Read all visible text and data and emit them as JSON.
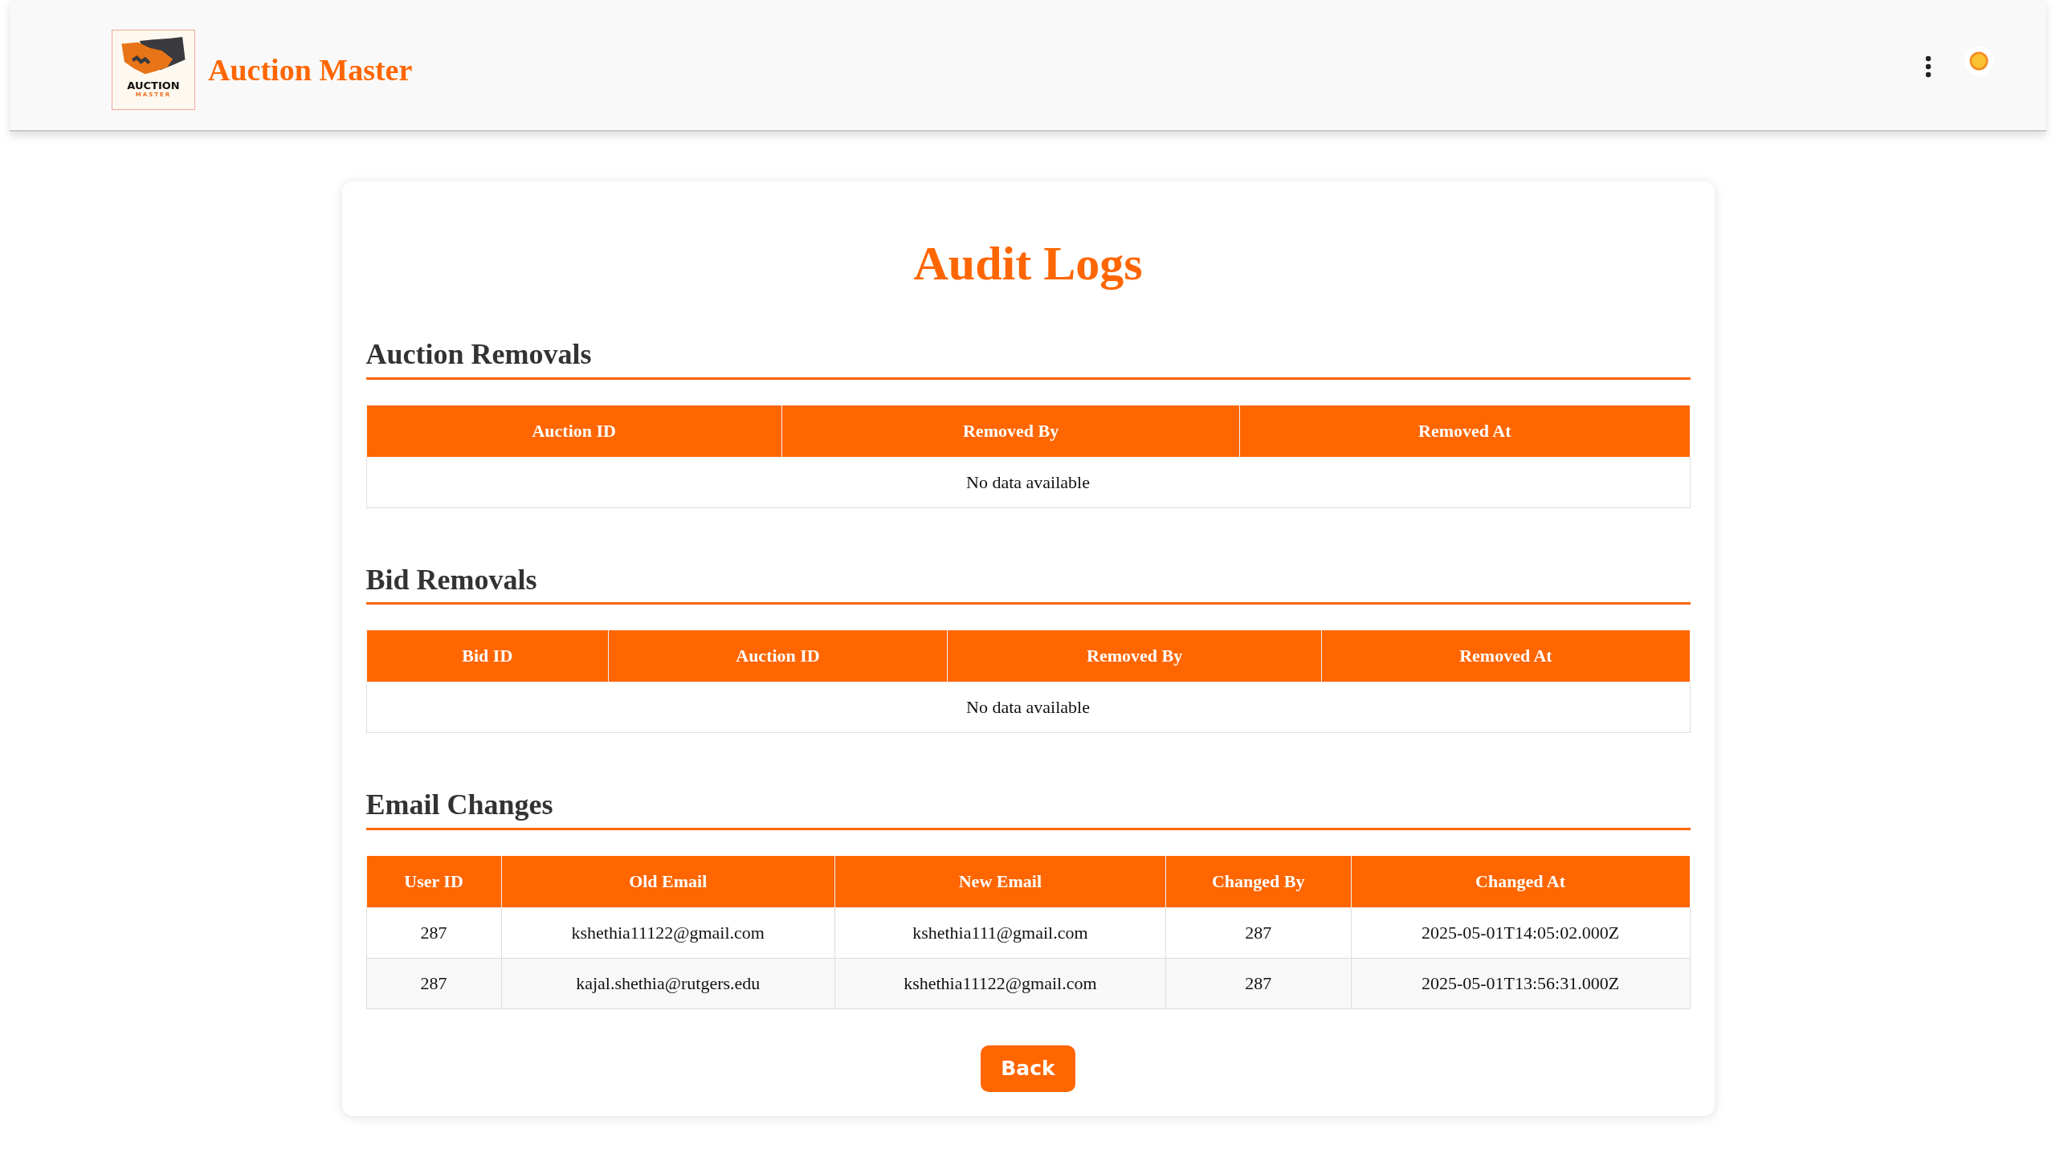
{
  "header": {
    "logo_text": "AUCTION",
    "logo_subtext": "MASTER",
    "title": "Auction Master"
  },
  "page_title": "Audit Logs",
  "sections": [
    {
      "heading": "Auction Removals",
      "columns": [
        "Auction ID",
        "Removed By",
        "Removed At"
      ],
      "empty_text": "No data available"
    },
    {
      "heading": "Bid Removals",
      "columns": [
        "Bid ID",
        "Auction ID",
        "Removed By",
        "Removed At"
      ],
      "empty_text": "No data available"
    },
    {
      "heading": "Email Changes",
      "columns": [
        "User ID",
        "Old Email",
        "New Email",
        "Changed By",
        "Changed At"
      ],
      "rows": [
        [
          "287",
          "kshethia11122@gmail.com",
          "kshethia111@gmail.com",
          "287",
          "2025-05-01T14:05:02.000Z"
        ],
        [
          "287",
          "kajal.shethia@rutgers.edu",
          "kshethia11122@gmail.com",
          "287",
          "2025-05-01T13:56:31.000Z"
        ]
      ]
    }
  ],
  "back_button": "Back"
}
